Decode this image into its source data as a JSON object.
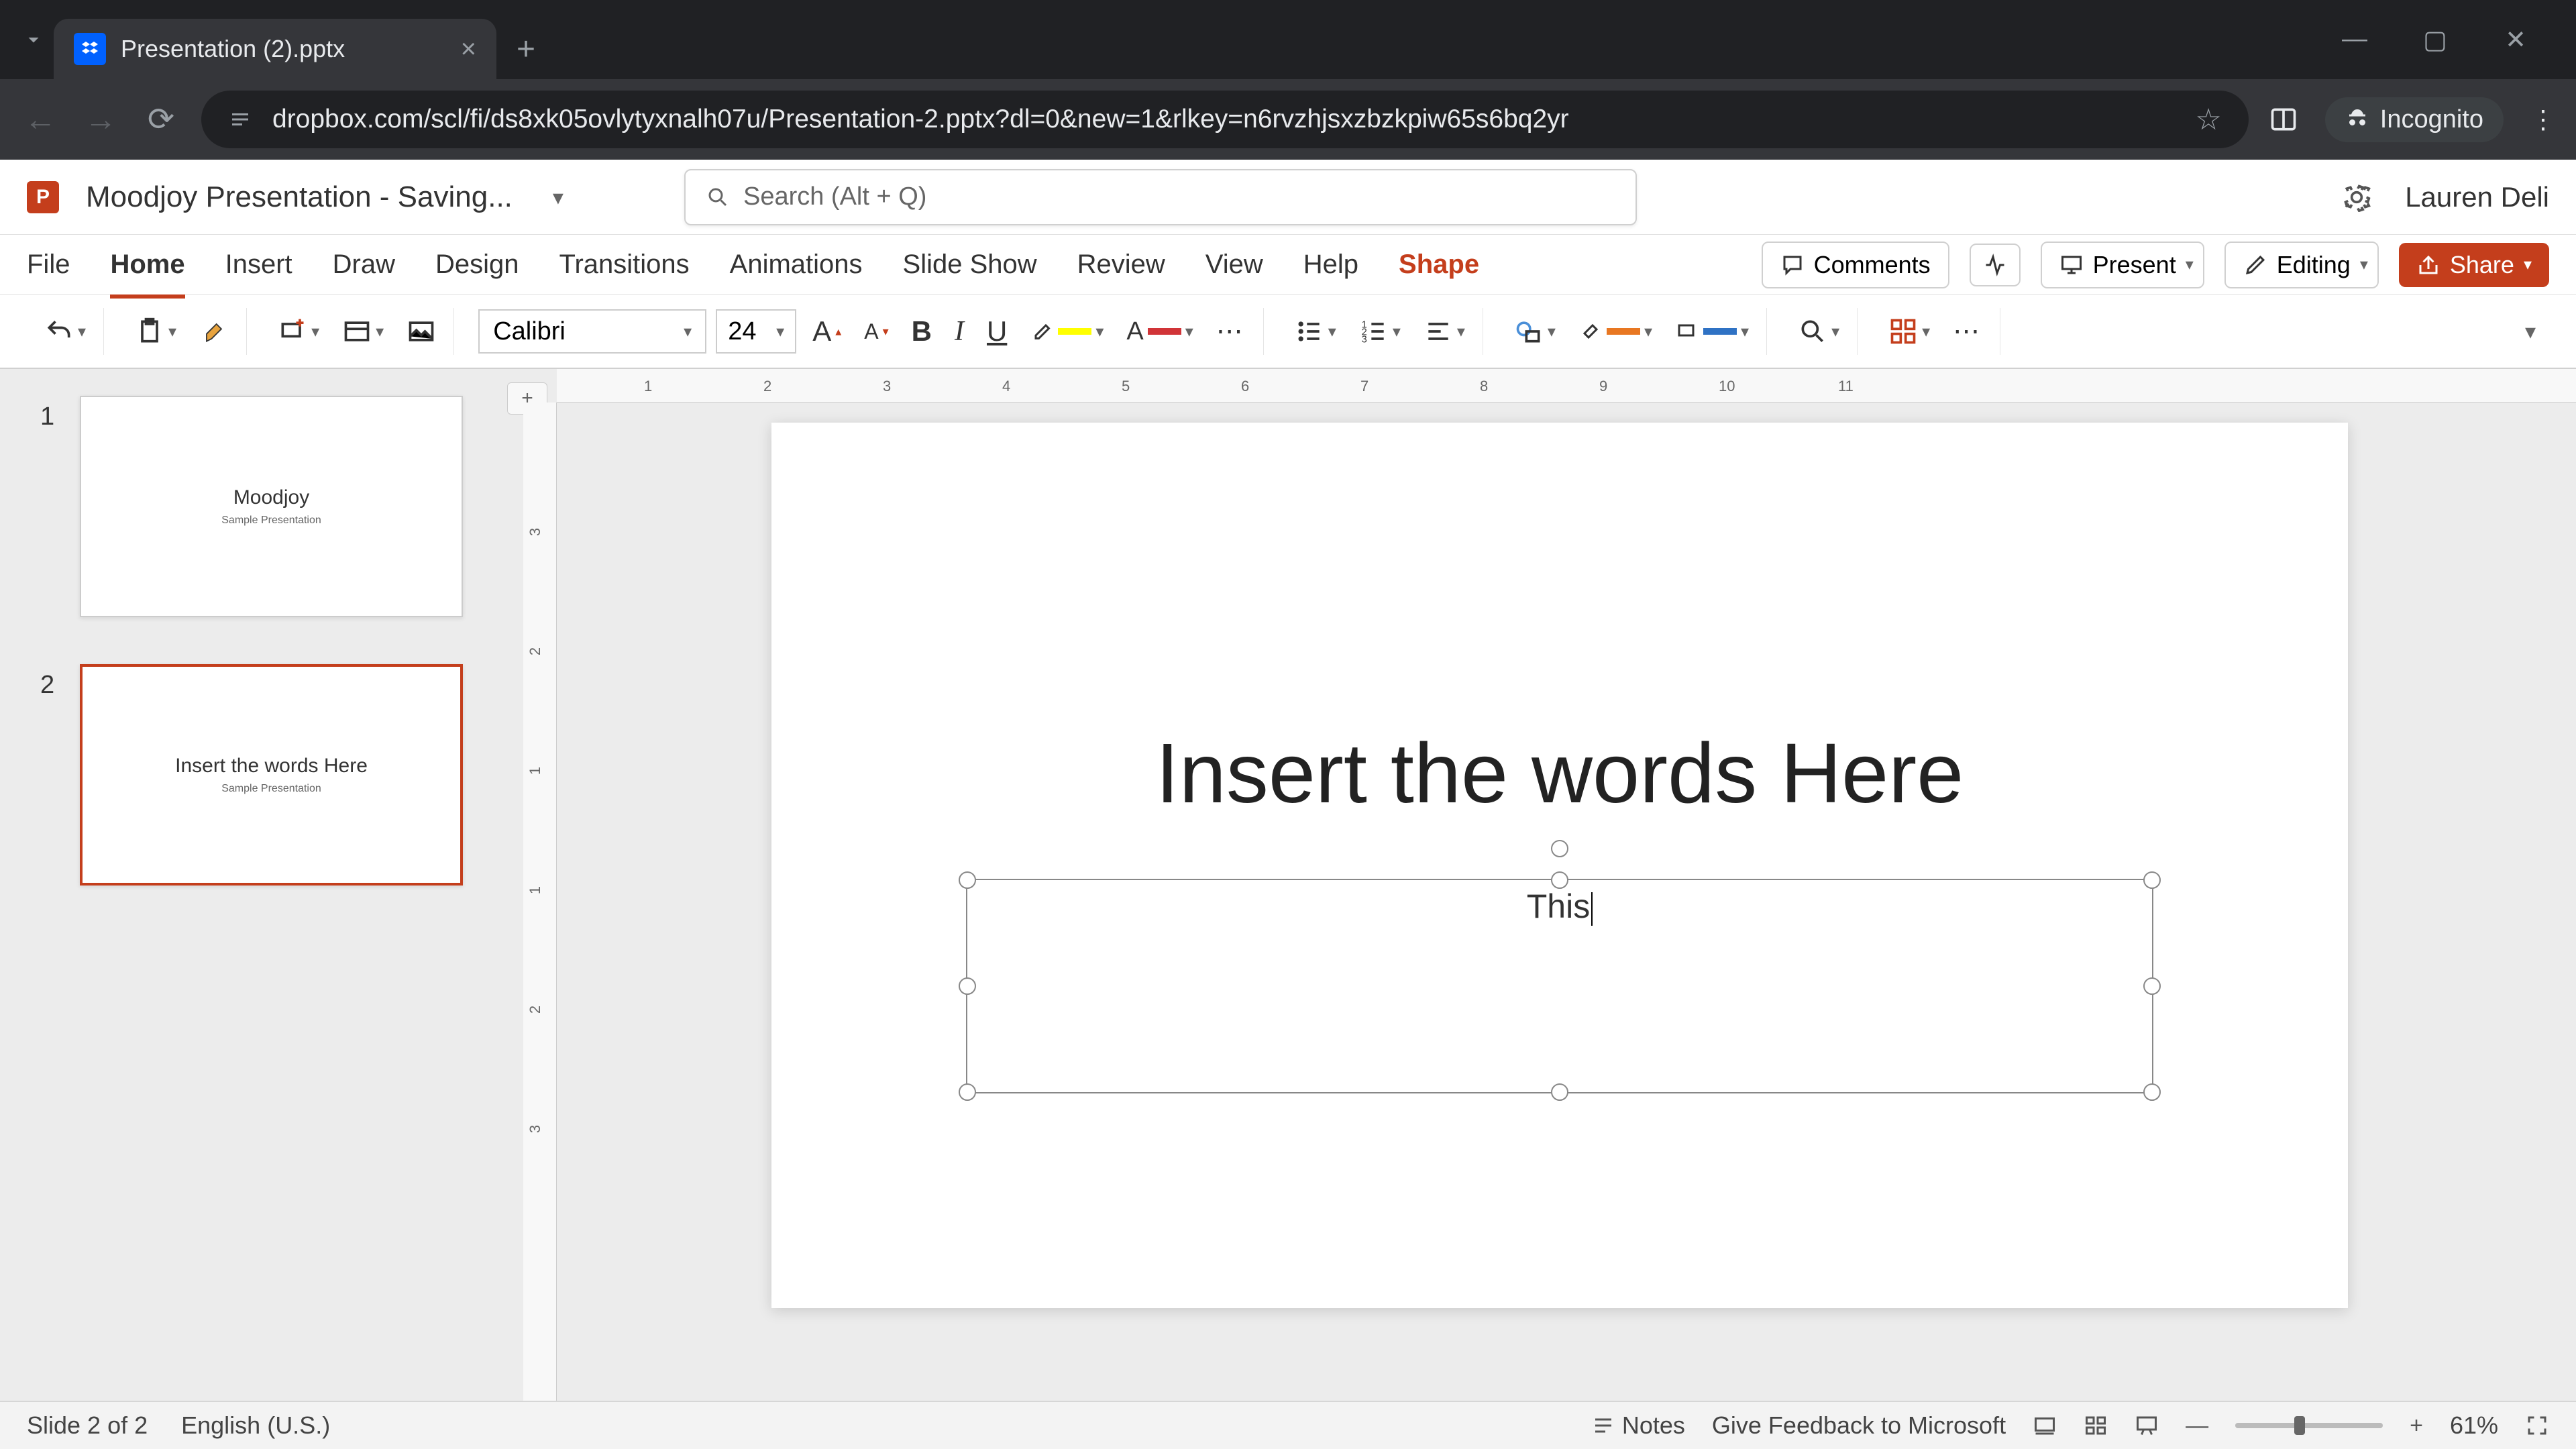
{
  "browser": {
    "tab_title": "Presentation (2).pptx",
    "url": "dropbox.com/scl/fi/ds8xk05ovlytyxnalh07u/Presentation-2.pptx?dl=0&new=1&rlkey=n6rvzhjsxzbzkpiw65s6bq2yr",
    "incognito_label": "Incognito"
  },
  "titlebar": {
    "doc_name": "Moodjoy Presentation  -  Saving...",
    "search_placeholder": "Search (Alt + Q)",
    "user_name": "Lauren Deli"
  },
  "ribbon_tabs": {
    "file": "File",
    "home": "Home",
    "insert": "Insert",
    "draw": "Draw",
    "design": "Design",
    "transitions": "Transitions",
    "animations": "Animations",
    "slideshow": "Slide Show",
    "review": "Review",
    "view": "View",
    "help": "Help",
    "shape": "Shape"
  },
  "ribbon_right": {
    "comments": "Comments",
    "present": "Present",
    "editing": "Editing",
    "share": "Share"
  },
  "toolbar": {
    "font_name": "Calibri",
    "font_size": "24"
  },
  "thumbnails": [
    {
      "num": "1",
      "title": "Moodjoy",
      "sub": "Sample Presentation"
    },
    {
      "num": "2",
      "title": "Insert the words Here",
      "sub": "Sample Presentation"
    }
  ],
  "slide": {
    "title": "Insert the words Here",
    "textbox_content": "This"
  },
  "ruler_h": [
    "1",
    "2",
    "3",
    "4",
    "5",
    "6",
    "7",
    "8",
    "9",
    "10",
    "11"
  ],
  "ruler_v": [
    "3",
    "2",
    "1",
    "1",
    "2",
    "3"
  ],
  "status": {
    "slide_info": "Slide 2 of 2",
    "language": "English (U.S.)",
    "notes": "Notes",
    "feedback": "Give Feedback to Microsoft",
    "zoom": "61%"
  }
}
